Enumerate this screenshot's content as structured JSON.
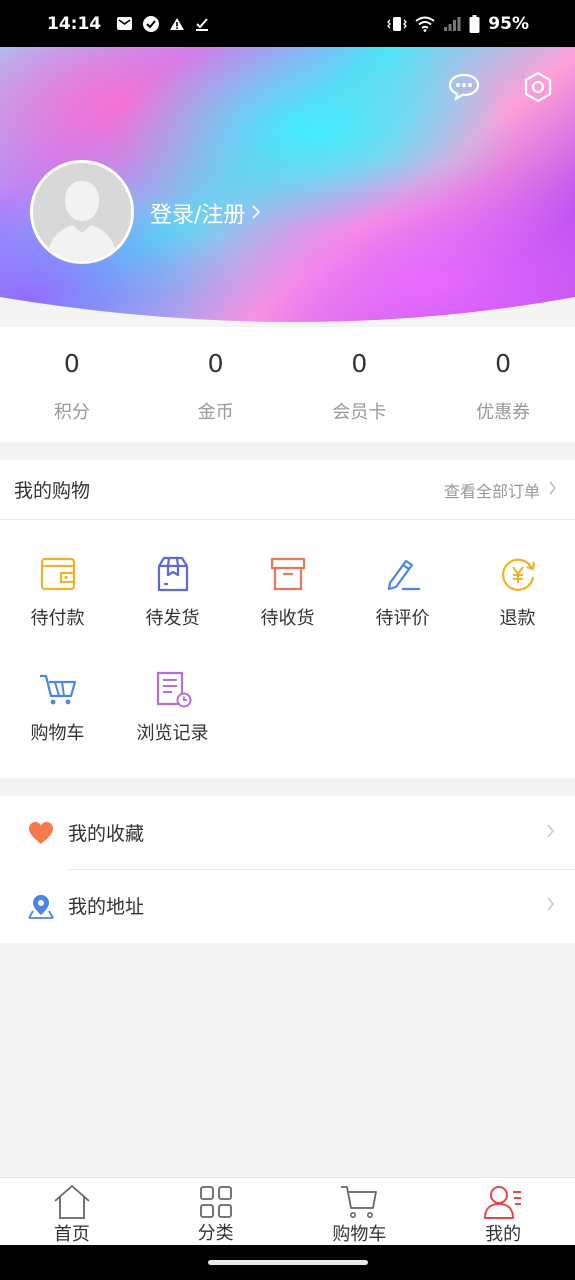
{
  "status_bar": {
    "time": "14:14",
    "battery": "95%"
  },
  "header": {
    "login_label": "登录/注册",
    "message_icon": "chat-bubble-icon",
    "settings_icon": "gear-icon"
  },
  "stats": [
    {
      "value": "0",
      "label": "积分"
    },
    {
      "value": "0",
      "label": "金币"
    },
    {
      "value": "0",
      "label": "会员卡"
    },
    {
      "value": "0",
      "label": "优惠券"
    }
  ],
  "shopping": {
    "title": "我的购物",
    "view_all": "查看全部订单",
    "items": [
      {
        "label": "待付款",
        "icon": "wallet-icon",
        "color": "#f1b227"
      },
      {
        "label": "待发货",
        "icon": "package-icon",
        "color": "#5d69d6"
      },
      {
        "label": "待收货",
        "icon": "box-icon",
        "color": "#ea7755"
      },
      {
        "label": "待评价",
        "icon": "pen-icon",
        "color": "#4b86e0"
      },
      {
        "label": "退款",
        "icon": "refund-icon",
        "color": "#f1b227"
      },
      {
        "label": "购物车",
        "icon": "cart-icon",
        "color": "#4b86e0"
      },
      {
        "label": "浏览记录",
        "icon": "history-icon",
        "color": "#b46ed8"
      }
    ]
  },
  "list": [
    {
      "label": "我的收藏",
      "icon": "heart-icon",
      "color": "#f47a4a"
    },
    {
      "label": "我的地址",
      "icon": "location-pin-icon",
      "color": "#4b86e0"
    }
  ],
  "bottom_nav": [
    {
      "label": "首页",
      "icon": "home-icon"
    },
    {
      "label": "分类",
      "icon": "grid-icon"
    },
    {
      "label": "购物车",
      "icon": "cart-icon"
    },
    {
      "label": "我的",
      "icon": "user-icon",
      "active": true
    }
  ],
  "colors": {
    "accent": "#e9434c",
    "muted": "#999999"
  }
}
